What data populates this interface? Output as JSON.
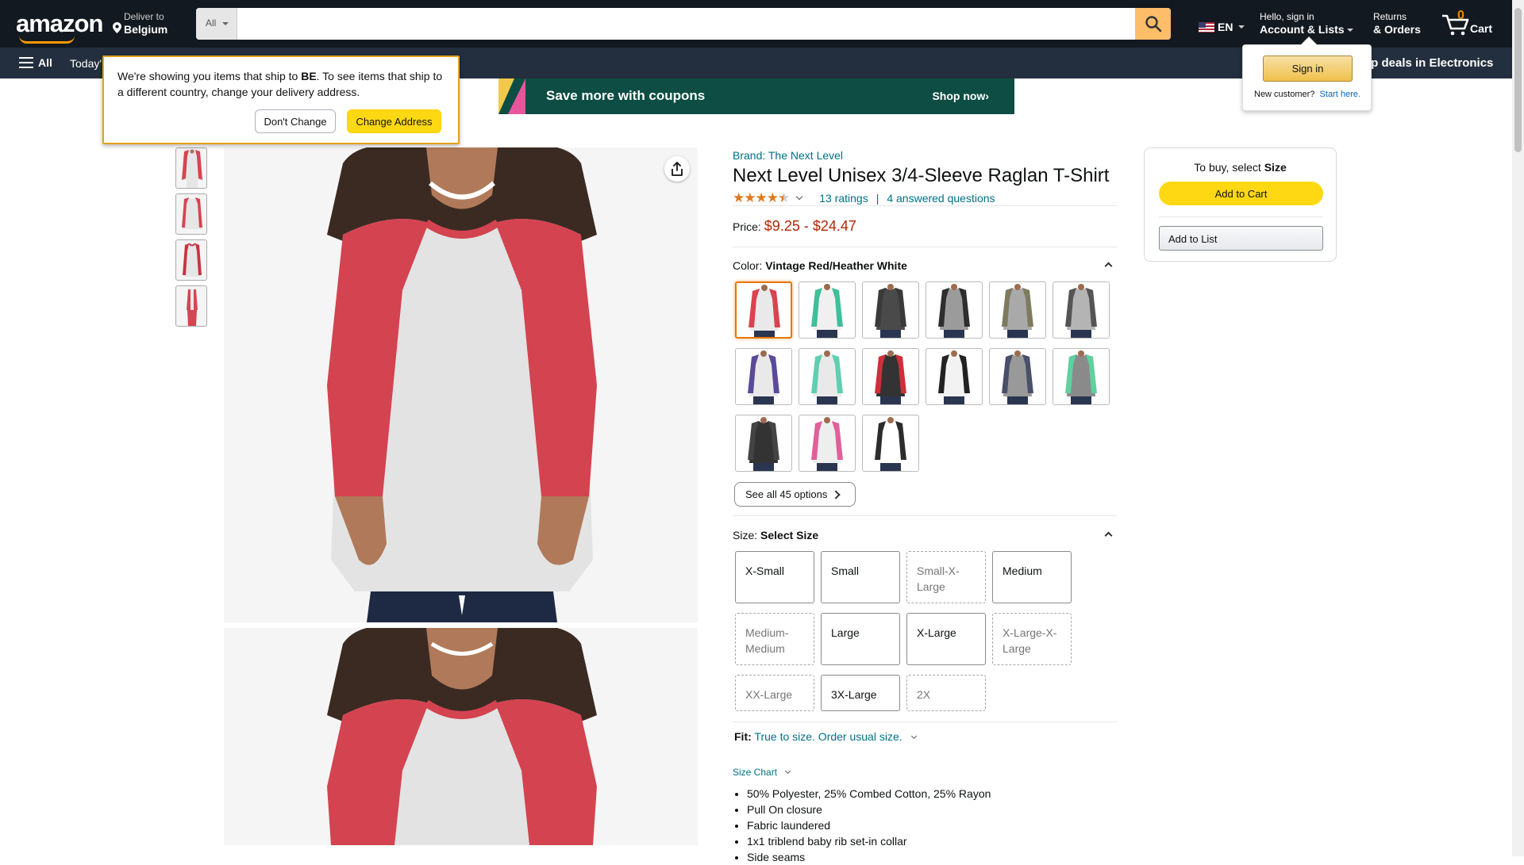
{
  "header": {
    "logo": "amazon",
    "deliver_to_label": "Deliver to",
    "deliver_to_country": "Belgium",
    "search_category": "All",
    "search_placeholder": "",
    "language": "EN",
    "account_line1": "Hello, sign in",
    "account_line2": "Account & Lists",
    "returns_line1": "Returns",
    "returns_line2": "& Orders",
    "cart_count": "0",
    "cart_label": "Cart"
  },
  "subnav": {
    "all_label": "All",
    "today_label": "Today'",
    "deals_label": "op deals in Electronics"
  },
  "banner": {
    "text": "Save more with coupons",
    "cta": "Shop now›"
  },
  "delivery_popover": {
    "message_part1": "We're showing you items that ship to ",
    "country_code": "BE",
    "message_part2": ". To see items that ship to a different country, change your delivery address.",
    "dont_change": "Don't Change",
    "change_address": "Change Address"
  },
  "signin_popover": {
    "button": "Sign in",
    "new_customer": "New customer?",
    "start_here": "Start here."
  },
  "product": {
    "brand": "Brand: The Next Level",
    "title": "Next Level Unisex 3/4-Sleeve Raglan T-Shirt",
    "stars": 4.5,
    "ratings_text": "13 ratings",
    "separator": "|",
    "questions_text": "4 answered questions",
    "price_label": "Price:",
    "price_range": "$9.25 - $24.47",
    "color_label": "Color: ",
    "color_value": "Vintage Red/Heather White",
    "see_all_label": "See all 45 options",
    "size_label": "Size: ",
    "size_value": "Select Size",
    "sizes": [
      {
        "label": "X-Small",
        "available": true
      },
      {
        "label": "Small",
        "available": true
      },
      {
        "label": "Small-X-Large",
        "available": false
      },
      {
        "label": "Medium",
        "available": true
      },
      {
        "label": "Medium-Medium",
        "available": false
      },
      {
        "label": "Large",
        "available": true
      },
      {
        "label": "X-Large",
        "available": true
      },
      {
        "label": "X-Large-X-Large",
        "available": false
      },
      {
        "label": "XX-Large",
        "available": false
      },
      {
        "label": "3X-Large",
        "available": true
      },
      {
        "label": "2X",
        "available": false
      }
    ],
    "fit_label": "Fit:",
    "fit_value": "True to size. Order usual size.",
    "size_chart": "Size Chart",
    "bullets": [
      "50% Polyester, 25% Combed Cotton, 25% Rayon",
      "Pull On closure",
      "Fabric laundered",
      "1x1 triblend baby rib set-in collar",
      "Side seams"
    ]
  },
  "swatch_colors": [
    {
      "sleeve": "#d9434f",
      "body": "#e9e9e9"
    },
    {
      "sleeve": "#3fbf9a",
      "body": "#f0f0f0"
    },
    {
      "sleeve": "#3a3a3a",
      "body": "#4a4a4a"
    },
    {
      "sleeve": "#2e2e2e",
      "body": "#9b9b9b"
    },
    {
      "sleeve": "#7d7a5e",
      "body": "#a9a9a9"
    },
    {
      "sleeve": "#555555",
      "body": "#b4b4b4"
    },
    {
      "sleeve": "#5a4a9a",
      "body": "#e9e9e9"
    },
    {
      "sleeve": "#5fcfb0",
      "body": "#e9e9e9"
    },
    {
      "sleeve": "#cf2f3a",
      "body": "#333333"
    },
    {
      "sleeve": "#222222",
      "body": "#f2f2f2"
    },
    {
      "sleeve": "#4a4f6a",
      "body": "#999999"
    },
    {
      "sleeve": "#5fd0a0",
      "body": "#8a8a8a"
    },
    {
      "sleeve": "#444444",
      "body": "#333333"
    },
    {
      "sleeve": "#e0609a",
      "body": "#eeeeee"
    },
    {
      "sleeve": "#2c2c2c",
      "body": "#ffffff"
    }
  ],
  "buybox": {
    "message": "To buy, select ",
    "message_bold": "Size",
    "add_to_cart": "Add to Cart",
    "add_to_list": "Add to List"
  },
  "colors": {
    "nav_bg": "#131921",
    "subnav_bg": "#232f3e",
    "link": "#007185",
    "price": "#b12704",
    "button_yellow": "#ffd814",
    "accent_orange": "#ff9900"
  }
}
